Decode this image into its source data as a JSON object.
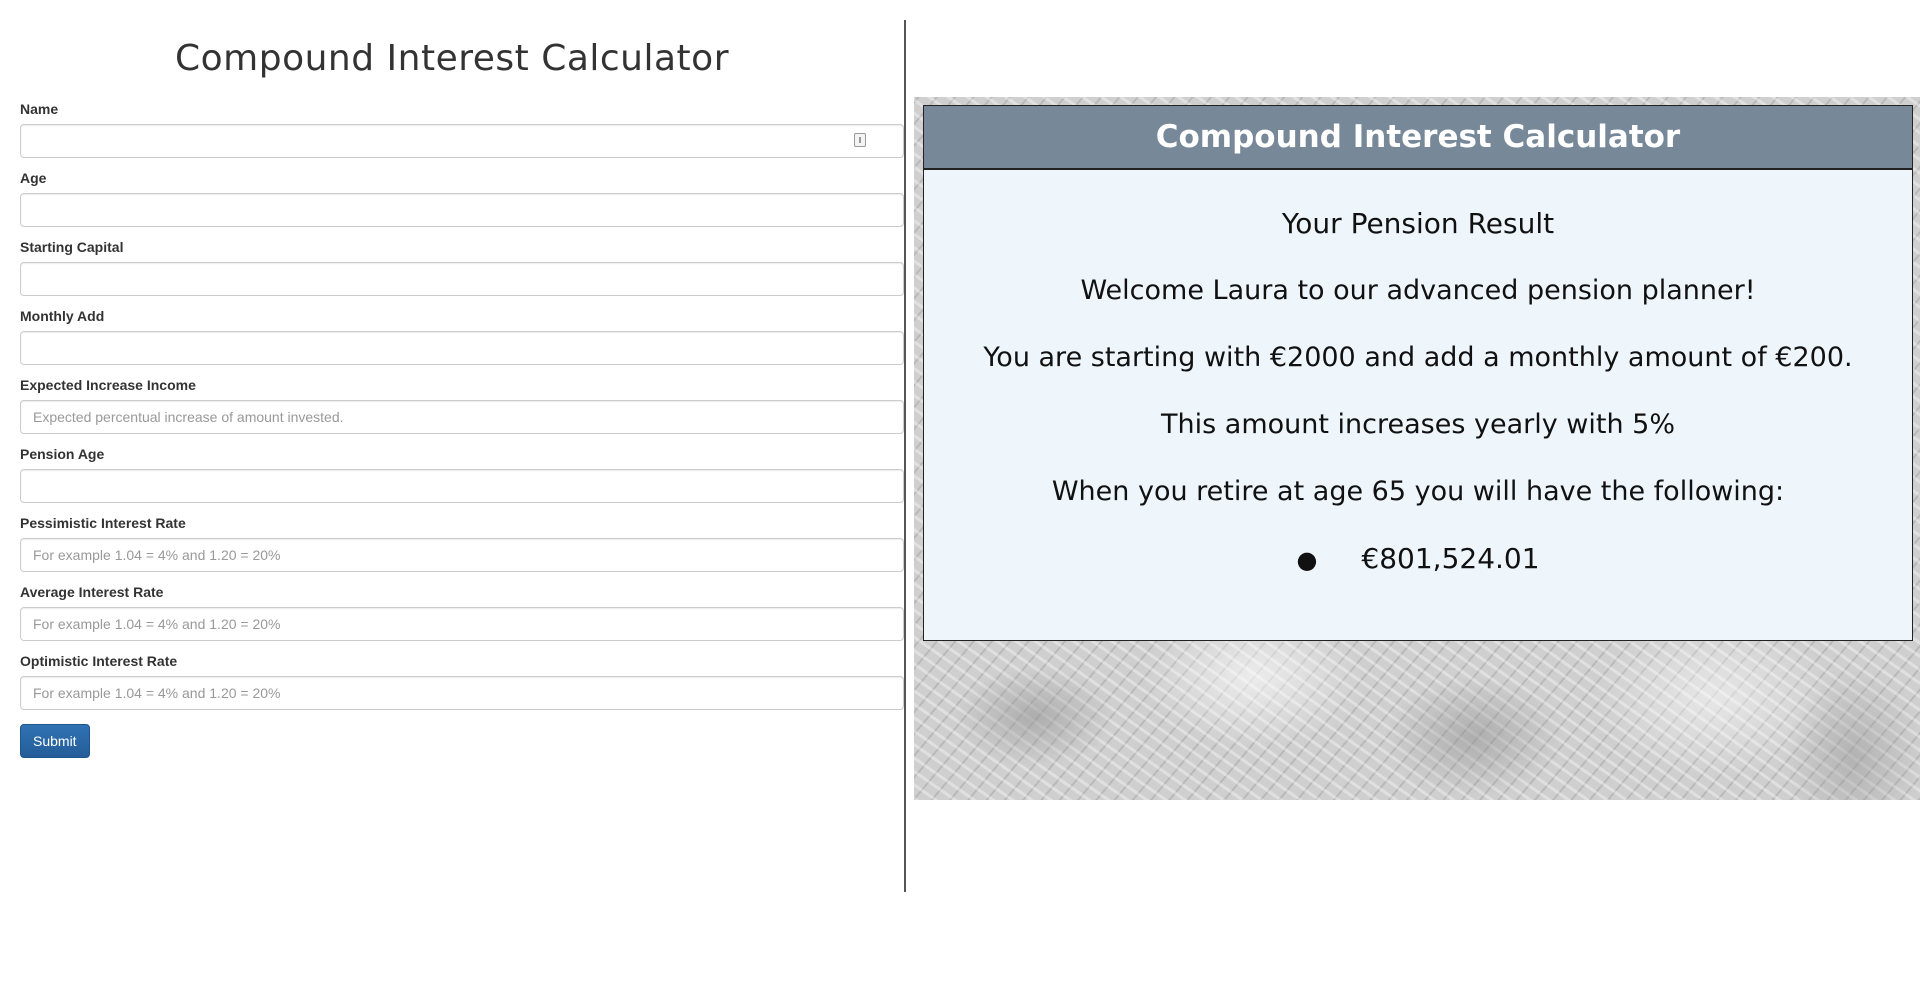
{
  "form": {
    "title": "Compound Interest Calculator",
    "fields": [
      {
        "label": "Name",
        "value": "",
        "placeholder": ""
      },
      {
        "label": "Age",
        "value": "",
        "placeholder": ""
      },
      {
        "label": "Starting Capital",
        "value": "",
        "placeholder": ""
      },
      {
        "label": "Monthly Add",
        "value": "",
        "placeholder": ""
      },
      {
        "label": "Expected Increase Income",
        "value": "",
        "placeholder": "Expected percentual increase of amount invested."
      },
      {
        "label": "Pension Age",
        "value": "",
        "placeholder": ""
      },
      {
        "label": "Pessimistic Interest Rate",
        "value": "",
        "placeholder": "For example 1.04 = 4% and 1.20 = 20%"
      },
      {
        "label": "Average Interest Rate",
        "value": "",
        "placeholder": "For example 1.04 = 4% and 1.20 = 20%"
      },
      {
        "label": "Optimistic Interest Rate",
        "value": "",
        "placeholder": "For example 1.04 = 4% and 1.20 = 20%"
      }
    ],
    "submit_label": "Submit"
  },
  "result": {
    "header": "Compound Interest Calculator",
    "title": "Your Pension Result",
    "welcome": "Welcome Laura to our advanced pension planner!",
    "starting": "You are starting with €2000 and add a monthly amount of €200.",
    "increase": "This amount increases yearly with 5%",
    "retire": "When you retire at age 65 you will have the following:",
    "amounts": [
      "€801,524.01"
    ]
  },
  "colors": {
    "header_bg": "#778899",
    "result_bg": "#eef6fc",
    "submit_bg": "#2a6aa8"
  }
}
